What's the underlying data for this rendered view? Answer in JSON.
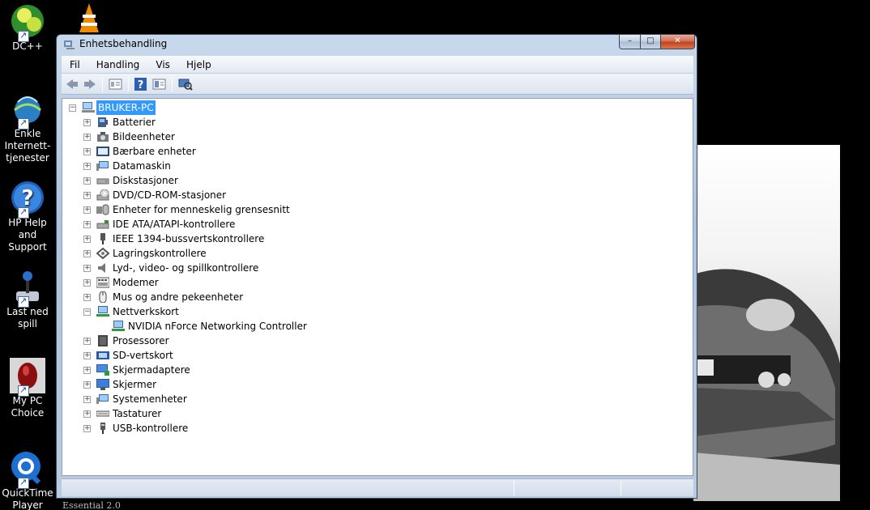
{
  "desktop": {
    "icons": [
      {
        "label": "DC++",
        "icon": "dcpp-icon"
      },
      {
        "label": "Enkle Internett-tjenester",
        "icon": "internet-services-icon"
      },
      {
        "label": "HP Help and Support",
        "icon": "help-icon"
      },
      {
        "label": "Last ned spill",
        "icon": "joystick-icon"
      },
      {
        "label": "My PC Choice",
        "icon": "mouse-icon"
      },
      {
        "label": "QuickTime Player",
        "icon": "quicktime-icon"
      }
    ],
    "footer_text": "Essential 2.0"
  },
  "window": {
    "title": "Enhetsbehandling",
    "controls": {
      "minimize": "–",
      "maximize": "□",
      "close": "✕"
    }
  },
  "menu": {
    "items": [
      "Fil",
      "Handling",
      "Vis",
      "Hjelp"
    ]
  },
  "toolbar": {
    "buttons": [
      "back-icon",
      "forward-icon",
      "properties-icon",
      "help-icon",
      "view-icon",
      "scan-hardware-icon"
    ]
  },
  "tree": {
    "root": "BRUKER-PC",
    "categories": [
      {
        "label": "Batterier",
        "icon": "battery-icon",
        "expanded": false
      },
      {
        "label": "Bildeenheter",
        "icon": "camera-icon",
        "expanded": false
      },
      {
        "label": "Bærbare enheter",
        "icon": "portable-device-icon",
        "expanded": false
      },
      {
        "label": "Datamaskin",
        "icon": "computer-icon",
        "expanded": false
      },
      {
        "label": "Diskstasjoner",
        "icon": "disk-drive-icon",
        "expanded": false
      },
      {
        "label": "DVD/CD-ROM-stasjoner",
        "icon": "dvd-icon",
        "expanded": false
      },
      {
        "label": "Enheter for menneskelig grensesnitt",
        "icon": "hid-icon",
        "expanded": false
      },
      {
        "label": "IDE ATA/ATAPI-kontrollere",
        "icon": "ide-controller-icon",
        "expanded": false
      },
      {
        "label": "IEEE 1394-bussvertskontrollere",
        "icon": "firewire-icon",
        "expanded": false
      },
      {
        "label": "Lagringskontrollere",
        "icon": "storage-controller-icon",
        "expanded": false
      },
      {
        "label": "Lyd-, video- og spillkontrollere",
        "icon": "speaker-icon",
        "expanded": false
      },
      {
        "label": "Modemer",
        "icon": "modem-icon",
        "expanded": false
      },
      {
        "label": "Mus og andre pekeenheter",
        "icon": "mouse-icon",
        "expanded": false
      },
      {
        "label": "Nettverkskort",
        "icon": "network-adapter-icon",
        "expanded": true,
        "children": [
          {
            "label": "NVIDIA nForce Networking Controller",
            "icon": "network-adapter-icon"
          }
        ]
      },
      {
        "label": "Prosessorer",
        "icon": "processor-icon",
        "expanded": false
      },
      {
        "label": "SD-vertskort",
        "icon": "sd-card-icon",
        "expanded": false
      },
      {
        "label": "Skjermadaptere",
        "icon": "display-adapter-icon",
        "expanded": false
      },
      {
        "label": "Skjermer",
        "icon": "monitor-icon",
        "expanded": false
      },
      {
        "label": "Systemenheter",
        "icon": "system-device-icon",
        "expanded": false
      },
      {
        "label": "Tastaturer",
        "icon": "keyboard-icon",
        "expanded": false
      },
      {
        "label": "USB-kontrollere",
        "icon": "usb-icon",
        "expanded": false
      }
    ]
  },
  "colors": {
    "selection": "#3399ff",
    "window_frame": "#aec4de",
    "desktop": "#000000"
  }
}
